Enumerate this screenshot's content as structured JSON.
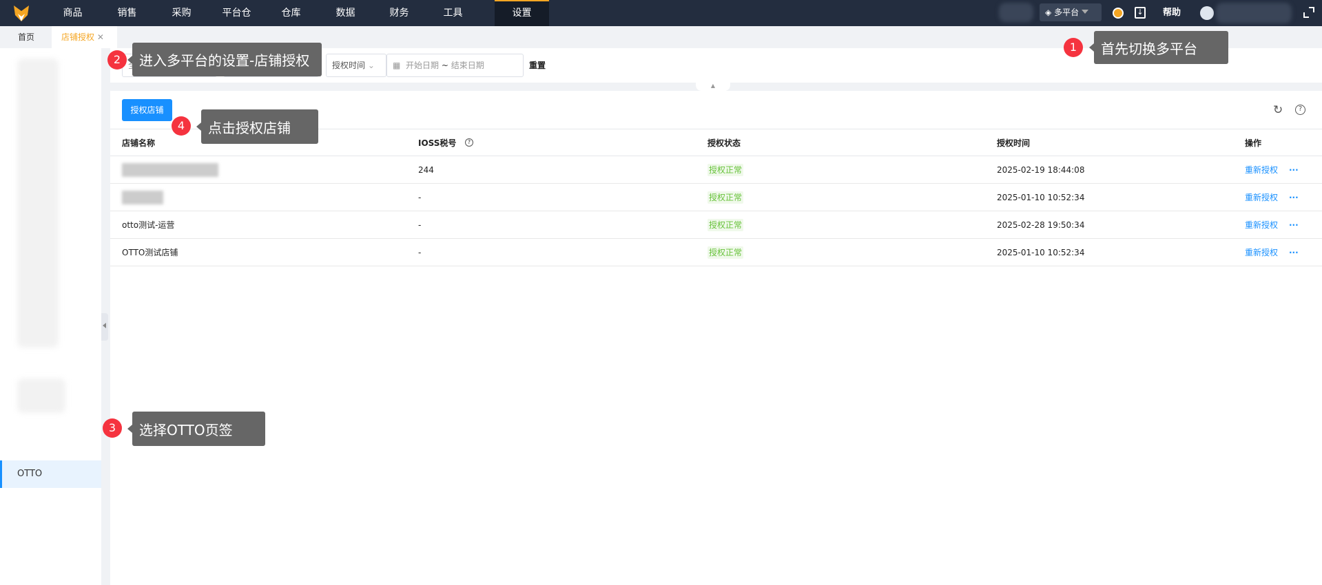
{
  "nav": {
    "items": [
      "商品",
      "销售",
      "采购",
      "平台仓",
      "仓库",
      "数据",
      "财务",
      "工具",
      "设置"
    ],
    "active": "设置",
    "platform": "多平台",
    "help": "帮助"
  },
  "tabs": {
    "home": "首页",
    "current": "店铺授权"
  },
  "sidebar": {
    "otto": "OTTO"
  },
  "filter": {
    "select1": "全部",
    "select3": "授权时间",
    "start_placeholder": "开始日期",
    "sep": "~",
    "end_placeholder": "结束日期",
    "reset": "重置"
  },
  "toolbar": {
    "authorize": "授权店铺"
  },
  "table": {
    "headers": [
      "店铺名称",
      "IOSS税号",
      "授权状态",
      "授权时间",
      "操作"
    ],
    "rows": [
      {
        "name": "",
        "ioss": "244",
        "status": "授权正常",
        "time": "2025-02-19 18:44:08",
        "action": "重新授权"
      },
      {
        "name": "",
        "ioss": "-",
        "status": "授权正常",
        "time": "2025-01-10 10:52:34",
        "action": "重新授权"
      },
      {
        "name": "otto测试-运营",
        "ioss": "-",
        "status": "授权正常",
        "time": "2025-02-28 19:50:34",
        "action": "重新授权"
      },
      {
        "name": "OTTO测试店铺",
        "ioss": "-",
        "status": "授权正常",
        "time": "2025-01-10 10:52:34",
        "action": "重新授权"
      }
    ]
  },
  "callouts": [
    {
      "n": "1",
      "text": "首先切换多平台"
    },
    {
      "n": "2",
      "text": "进入多平台的设置-店铺授权"
    },
    {
      "n": "3",
      "text": "选择OTTO页签"
    },
    {
      "n": "4",
      "text": "点击授权店铺"
    }
  ],
  "colors": {
    "primary": "#1890ff",
    "accent": "#f5a623",
    "nav": "#232d3f",
    "ok": "#67c23a",
    "badge": "#f5333f"
  }
}
